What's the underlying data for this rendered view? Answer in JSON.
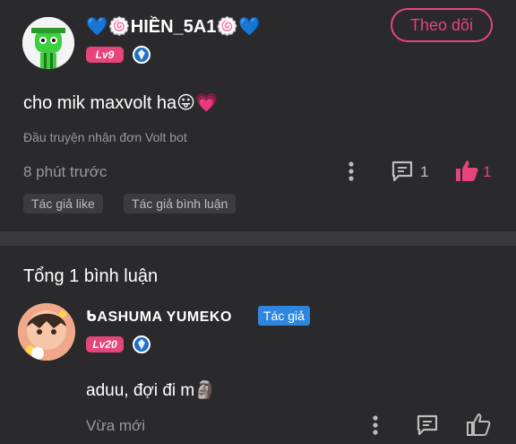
{
  "post": {
    "username": "💙🍥HIỀN_5A1🍥💙",
    "level": "Lv9",
    "follow_label": "Theo dõi",
    "content": "cho mik maxvolt ha😛💗",
    "subtitle": "Đầu truyện nhận đơn Volt bot",
    "time": "8 phút trước",
    "comment_count": "1",
    "like_count": "1",
    "tags": [
      "Tác giả like",
      "Tác giả bình luận"
    ]
  },
  "comments_section": {
    "total_label": "Tổng 1 bình luận",
    "comment": {
      "username": "ᑲASHUMA YUMEKO",
      "author_badge": "Tác giả",
      "level": "Lv20",
      "content": "aduu, đợi đi m🗿",
      "time": "Vừa mới"
    }
  },
  "colors": {
    "accent": "#e5457a",
    "background": "#2a2a2c",
    "badge_blue": "#2e86de",
    "separator": "#3a3a3c"
  },
  "icons": [
    "more-vert-icon",
    "comment-icon",
    "thumb-up-icon"
  ]
}
